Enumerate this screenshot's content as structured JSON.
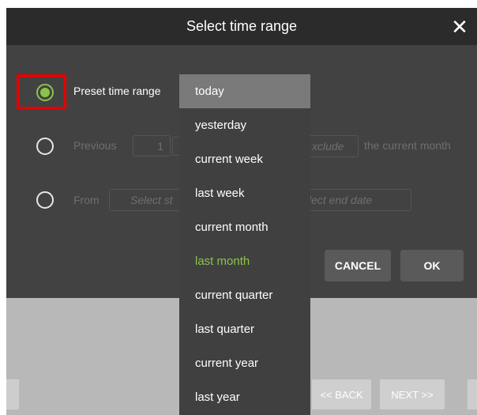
{
  "dialog": {
    "title": "Select time range",
    "close_glyph": "✕"
  },
  "options": {
    "preset": {
      "label": "Preset time range",
      "selected": true
    },
    "previous": {
      "label": "Previous",
      "count": "1",
      "exclude_partial": "xclude",
      "suffix": "the current month"
    },
    "from": {
      "label": "From",
      "start_placeholder_partial": "Select st",
      "end_placeholder_partial": "lect end date"
    }
  },
  "buttons": {
    "cancel": "CANCEL",
    "ok": "OK"
  },
  "dropdown": {
    "items": [
      "today",
      "yesterday",
      "current week",
      "last week",
      "current month",
      "last month",
      "current quarter",
      "last quarter",
      "current year",
      "last year"
    ],
    "highlighted": "today",
    "current": "last month"
  },
  "nav": {
    "back": "<< BACK",
    "next": "NEXT >>"
  },
  "colors": {
    "accent": "#8bc34a",
    "highlight_frame": "#e40000",
    "header": "#2b2b2b",
    "panel": "#424242"
  }
}
